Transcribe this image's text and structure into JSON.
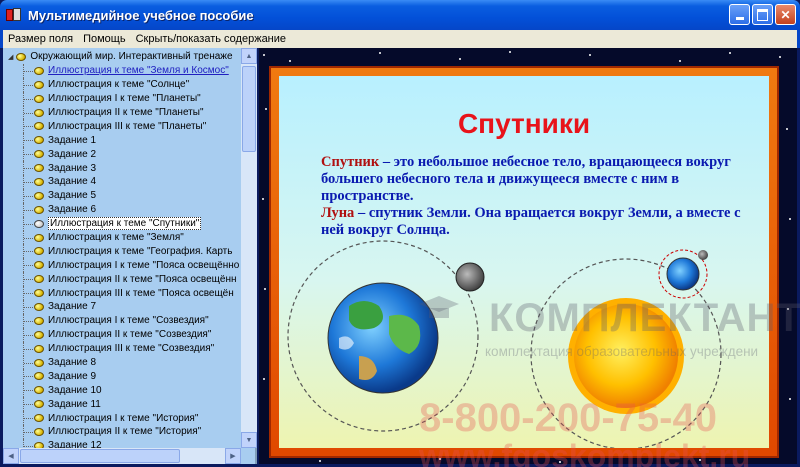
{
  "window": {
    "title": "Мультимедийное учебное пособие",
    "icon": "app-icon",
    "buttons": [
      "minimize-icon",
      "maximize-icon",
      "close-icon"
    ]
  },
  "menu": {
    "items": [
      "Размер поля",
      "Помощь",
      "Скрыть/показать содержание"
    ]
  },
  "tree": {
    "root_label": "Окружающий мир. Интерактивный тренаже",
    "items": [
      {
        "label": "Иллюстрация к теме \"Земля и Космос\"",
        "state": "link"
      },
      {
        "label": "Иллюстрация к теме \"Солнце\""
      },
      {
        "label": "Иллюстрация I к теме \"Планеты\""
      },
      {
        "label": "Иллюстрация II к теме \"Планеты\""
      },
      {
        "label": "Иллюстрация III к теме \"Планеты\""
      },
      {
        "label": "Задание 1"
      },
      {
        "label": "Задание 2"
      },
      {
        "label": "Задание 3"
      },
      {
        "label": "Задание 4"
      },
      {
        "label": "Задание 5"
      },
      {
        "label": "Задание 6"
      },
      {
        "label": "Иллюстрация к теме \"Спутники\"",
        "state": "selected"
      },
      {
        "label": "Иллюстрация к теме \"Земля\""
      },
      {
        "label": "Иллюстрация к теме \"География. Карть"
      },
      {
        "label": "Иллюстрация I к теме \"Пояса освещённо"
      },
      {
        "label": "Иллюстрация II к теме \"Пояса освещённ"
      },
      {
        "label": "Иллюстрация III к теме \"Пояса освещён"
      },
      {
        "label": "Задание 7"
      },
      {
        "label": "Иллюстрация I к теме \"Созвездия\""
      },
      {
        "label": "Иллюстрация II к теме \"Созвездия\""
      },
      {
        "label": "Иллюстрация III к теме \"Созвездия\""
      },
      {
        "label": "Задание 8"
      },
      {
        "label": "Задание 9"
      },
      {
        "label": "Задание 10"
      },
      {
        "label": "Задание 11"
      },
      {
        "label": "Иллюстрация I к теме \"История\""
      },
      {
        "label": "Иллюстрация II к теме \"История\""
      },
      {
        "label": "Задание 12"
      }
    ]
  },
  "slide": {
    "title": "Спутники",
    "para1_term": "Спутник",
    "para1_text": " – это небольшое небесное тело, вращающееся вокруг большего небесного тела и движущееся вместе с ним в пространстве.",
    "para2_term": "Луна",
    "para2_text": " – спутник Земли. Она вращается вокруг Земли, а вместе с ней вокруг Солнца."
  },
  "watermark": {
    "brand": "КОМПЛЕКТАНТ",
    "tagline": "комплектация образовательных учреждени",
    "phone": "8-800-200-75-40",
    "site": "www.fgoskomplekt.ru"
  },
  "colors": {
    "title_red": "#e8131a",
    "body_blue": "#0a1ab0",
    "term_red": "#b01010",
    "frame_orange": "#f07a10",
    "tree_bg": "#a8cdf0"
  }
}
